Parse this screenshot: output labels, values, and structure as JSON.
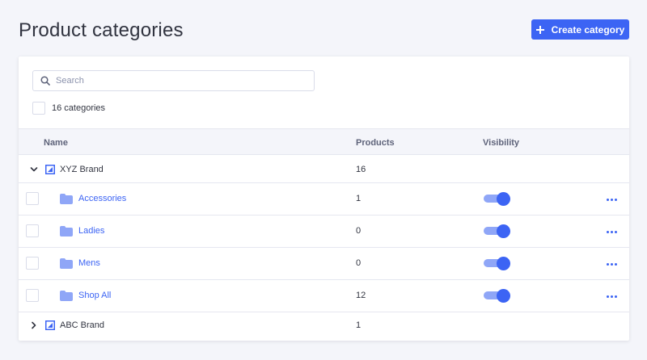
{
  "header": {
    "title": "Product categories",
    "create_label": "Create category"
  },
  "search": {
    "placeholder": "Search",
    "value": ""
  },
  "selection": {
    "count_label": "16 categories"
  },
  "table": {
    "columns": [
      "Name",
      "Products",
      "Visibility"
    ],
    "rows": [
      {
        "type": "brand",
        "name": "XYZ Brand",
        "products": "16",
        "expanded": true
      },
      {
        "type": "category",
        "name": "Accessories",
        "products": "1",
        "visible": true
      },
      {
        "type": "category",
        "name": "Ladies",
        "products": "0",
        "visible": true
      },
      {
        "type": "category",
        "name": "Mens",
        "products": "0",
        "visible": true
      },
      {
        "type": "category",
        "name": "Shop All",
        "products": "12",
        "visible": true
      },
      {
        "type": "brand",
        "name": "ABC Brand",
        "products": "1",
        "expanded": false
      }
    ]
  },
  "colors": {
    "accent": "#3c64f4",
    "toggle_track": "#8fa6f7",
    "folder": "#8fa6f7",
    "background": "#f4f5fa"
  },
  "icons": {
    "search": "search-icon",
    "create": "plus-icon",
    "expand": "chevron-down-icon",
    "collapse": "chevron-right-icon",
    "brand": "brand-logo-icon",
    "folder": "folder-icon",
    "more": "more-actions-icon"
  }
}
